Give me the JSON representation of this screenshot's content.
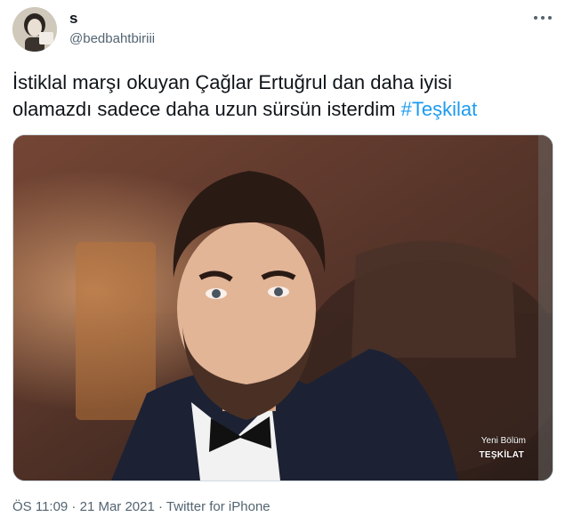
{
  "author": {
    "display_name": "s",
    "handle": "@bedbahtbiriii"
  },
  "tweet": {
    "text_line1": "İstiklal marşı okuyan Çağlar Ertuğrul dan daha iyisi",
    "text_line2": "olamazdı sadece daha uzun sürsün isterdim",
    "hashtag": "#Teşkilat"
  },
  "media": {
    "overlay_line1": "Yeni Bölüm",
    "overlay_line2": "TEŞKİLAT"
  },
  "meta": {
    "time": "ÖS 11:09",
    "separator1": " · ",
    "date": "21 Mar 2021",
    "separator2": " · ",
    "source": "Twitter for iPhone"
  },
  "icons": {
    "more": "more-icon",
    "avatar": "avatar"
  },
  "colors": {
    "hashtag": "#1d9bf0",
    "secondary_text": "#536471"
  }
}
